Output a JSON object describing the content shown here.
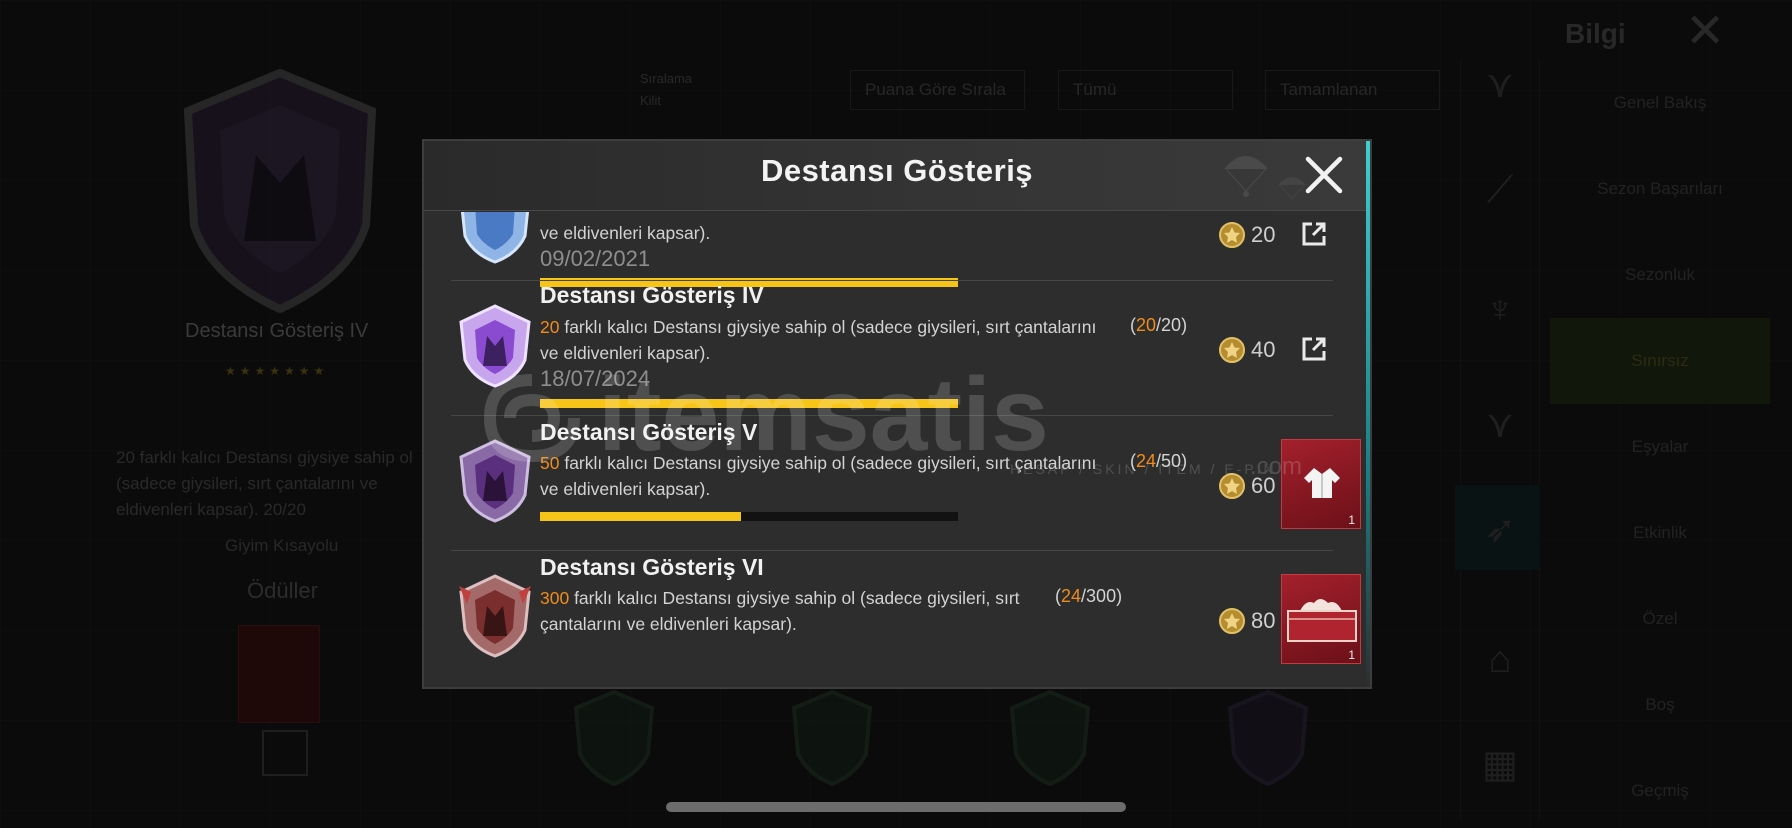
{
  "modal": {
    "title": "Destansı Gösteriş",
    "close_icon": "close-icon"
  },
  "achievements": [
    {
      "title": "",
      "desc_prefix": "",
      "desc_body": "ve eldivenleri kapsar).",
      "date": "09/02/2021",
      "points": "20",
      "progress_fraction": 1.0,
      "reward": "share-icon"
    },
    {
      "title": "Destansı Gösteriş IV",
      "desc_prefix": "20",
      "desc_body": " farklı kalıcı Destansı giysiye sahip ol (sadece giysileri, sırt çantalarını ve eldivenleri kapsar).",
      "progress_current": "20",
      "progress_total": "20",
      "date": "18/07/2024",
      "points": "40",
      "progress_fraction": 1.0,
      "reward": "share-icon"
    },
    {
      "title": "Destansı Gösteriş V",
      "desc_prefix": "50",
      "desc_body": " farklı kalıcı Destansı giysiye sahip ol (sadece giysileri, sırt çantalarını ve eldivenleri kapsar).",
      "progress_current": "24",
      "progress_total": "50",
      "points": "60",
      "progress_fraction": 0.48,
      "reward": "outfit-reward",
      "reward_qty": "1"
    },
    {
      "title": "Destansı Gösteriş VI",
      "desc_prefix": "300",
      "desc_body": " farklı kalıcı Destansı giysiye sahip ol (sadece giysileri, sırt çantalarını ve eldivenleri kapsar).",
      "progress_current": "24",
      "progress_total": "300",
      "points": "80",
      "reward": "crate-reward",
      "reward_qty": "1"
    }
  ],
  "progress_format": {
    "open": "(",
    "sep": "/",
    "close": ")"
  },
  "background": {
    "badge_name": "Destansı Gösteriş IV",
    "stars": "★★★★★★★",
    "clothing_label": "Giyim Kısayolu",
    "rewards_label": "Ödüller",
    "desc": "20 farklı kalıcı Destansı giysiye sahip ol (sadece giysileri, sırt çantalarını ve eldivenleri kapsar). 20/20",
    "sort_lines": [
      "Sıralama",
      "Kilit"
    ],
    "dropdowns": [
      "Puana Göre Sırala",
      "Tümü",
      "Tamamlanan"
    ],
    "top_button": "Bilgi",
    "menu": [
      "Genel Bakış",
      "Sezon Başarıları",
      "Sezonluk",
      "Sınırsız",
      "Eşyalar",
      "Etkinlik",
      "Özel",
      "Boş",
      "Geçmiş"
    ]
  },
  "watermark": {
    "brand": "itemsatis",
    "tagline": "HESAP / SKIN / ITEM / E-PIN",
    "suffix": ".com"
  },
  "colors": {
    "accent_orange": "#f08c1a",
    "progress_yellow": "#f7c418",
    "reward_red": "#8c1620",
    "modal_bg": "#2d2d2d"
  }
}
